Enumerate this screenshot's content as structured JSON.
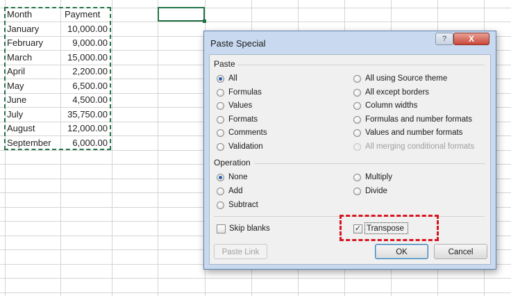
{
  "sheet": {
    "header_month": "Month",
    "header_payment": "Payment",
    "rows": [
      {
        "month": "January",
        "payment": "10,000.00"
      },
      {
        "month": "February",
        "payment": "9,000.00"
      },
      {
        "month": "March",
        "payment": "15,000.00"
      },
      {
        "month": "April",
        "payment": "2,200.00"
      },
      {
        "month": "May",
        "payment": "6,500.00"
      },
      {
        "month": "June",
        "payment": "4,500.00"
      },
      {
        "month": "July",
        "payment": "35,750.00"
      },
      {
        "month": "August",
        "payment": "12,000.00"
      },
      {
        "month": "September",
        "payment": "6,000.00"
      }
    ],
    "accent_color": "#217346"
  },
  "dialog": {
    "title": "Paste Special",
    "help_label": "?",
    "close_label": "X",
    "paste_section_label": "Paste",
    "paste_options_left": [
      {
        "label": "All",
        "selected": true
      },
      {
        "label": "Formulas",
        "selected": false
      },
      {
        "label": "Values",
        "selected": false
      },
      {
        "label": "Formats",
        "selected": false
      },
      {
        "label": "Comments",
        "selected": false
      },
      {
        "label": "Validation",
        "selected": false
      }
    ],
    "paste_options_right": [
      {
        "label": "All using Source theme",
        "selected": false
      },
      {
        "label": "All except borders",
        "selected": false
      },
      {
        "label": "Column widths",
        "selected": false
      },
      {
        "label": "Formulas and number formats",
        "selected": false
      },
      {
        "label": "Values and number formats",
        "selected": false
      },
      {
        "label": "All merging conditional formats",
        "selected": false,
        "disabled": true
      }
    ],
    "operation_section_label": "Operation",
    "operation_options_left": [
      {
        "label": "None",
        "selected": true
      },
      {
        "label": "Add",
        "selected": false
      },
      {
        "label": "Subtract",
        "selected": false
      }
    ],
    "operation_options_right": [
      {
        "label": "Multiply",
        "selected": false
      },
      {
        "label": "Divide",
        "selected": false
      }
    ],
    "skip_blanks": {
      "label": "Skip blanks",
      "checked": false
    },
    "transpose": {
      "label": "Transpose",
      "checked": true,
      "check_mark": "✓"
    },
    "buttons": {
      "paste_link": "Paste Link",
      "ok": "OK",
      "cancel": "Cancel"
    },
    "highlight_color": "#d9141e"
  }
}
